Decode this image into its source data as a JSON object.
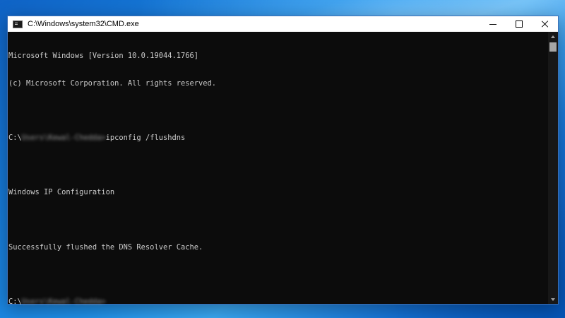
{
  "window": {
    "title": "C:\\Windows\\system32\\CMD.exe"
  },
  "console": {
    "lines": [
      {
        "text": "Microsoft Windows [Version 10.0.19044.1766]"
      },
      {
        "text": "(c) Microsoft Corporation. All rights reserved."
      },
      {
        "text": ""
      },
      {
        "prefix": "C:\\",
        "blurred": "Users\\Kewal-Chedda>",
        "suffix": "ipconfig /flushdns"
      },
      {
        "text": ""
      },
      {
        "text": "Windows IP Configuration"
      },
      {
        "text": ""
      },
      {
        "text": "Successfully flushed the DNS Resolver Cache."
      },
      {
        "text": ""
      },
      {
        "prefix": "C:\\",
        "blurred": "Users\\Kewal-Chedda>",
        "suffix": ""
      }
    ]
  },
  "colors": {
    "console_bg": "#0c0c0c",
    "console_fg": "#cccccc",
    "titlebar_bg": "#ffffff",
    "desktop_accent": "#1e8fe8"
  },
  "icons": {
    "app": "cmd-app-icon",
    "minimize": "minimize-icon",
    "maximize": "maximize-icon",
    "close": "close-icon"
  }
}
